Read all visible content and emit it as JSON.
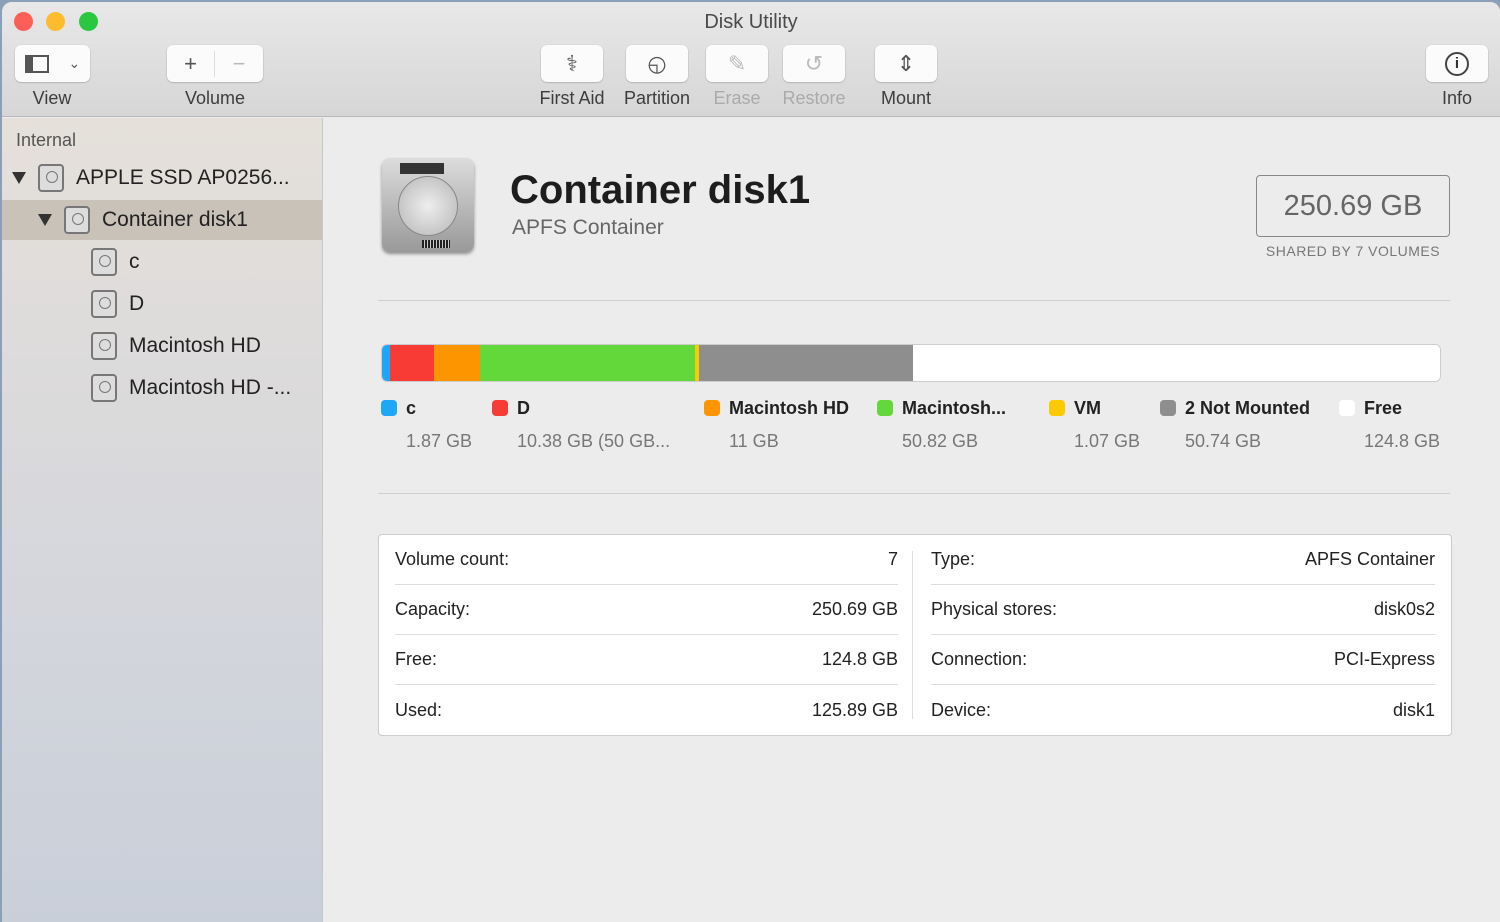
{
  "window": {
    "title": "Disk Utility"
  },
  "toolbar": {
    "view": "View",
    "volume": "Volume",
    "first_aid": "First Aid",
    "partition": "Partition",
    "erase": "Erase",
    "restore": "Restore",
    "mount": "Mount",
    "info": "Info"
  },
  "sidebar": {
    "section": "Internal",
    "items": [
      {
        "label": "APPLE SSD AP0256...",
        "level": 0,
        "expanded": true
      },
      {
        "label": "Container disk1",
        "level": 1,
        "expanded": true,
        "selected": true
      },
      {
        "label": "c",
        "level": 2
      },
      {
        "label": "D",
        "level": 2
      },
      {
        "label": "Macintosh HD",
        "level": 2
      },
      {
        "label": "Macintosh HD -...",
        "level": 2
      }
    ]
  },
  "header": {
    "title": "Container disk1",
    "subtitle": "APFS Container",
    "capacity": "250.69 GB",
    "capacity_label": "SHARED BY 7 VOLUMES"
  },
  "usage": [
    {
      "name": "c",
      "value": "1.87 GB",
      "gb": 1.87,
      "color": "#1ea7f5"
    },
    {
      "name": "D",
      "value": "10.38 GB (50 GB...",
      "gb": 10.38,
      "color": "#f93b35"
    },
    {
      "name": "Macintosh HD",
      "value": "11 GB",
      "gb": 11,
      "color": "#fd9500"
    },
    {
      "name": "Macintosh...",
      "value": "50.82 GB",
      "gb": 50.82,
      "color": "#62d83b"
    },
    {
      "name": "VM",
      "value": "1.07 GB",
      "gb": 1.07,
      "color": "#fdca00"
    },
    {
      "name": "2 Not Mounted",
      "value": "50.74 GB",
      "gb": 50.74,
      "color": "#8e8e8e"
    },
    {
      "name": "Free",
      "value": "124.8 GB",
      "gb": 124.8,
      "color": "#ffffff"
    }
  ],
  "details": {
    "left": [
      {
        "k": "Volume count:",
        "v": "7"
      },
      {
        "k": "Capacity:",
        "v": "250.69 GB"
      },
      {
        "k": "Free:",
        "v": "124.8 GB"
      },
      {
        "k": "Used:",
        "v": "125.89 GB"
      }
    ],
    "right": [
      {
        "k": "Type:",
        "v": "APFS Container"
      },
      {
        "k": "Physical stores:",
        "v": "disk0s2"
      },
      {
        "k": "Connection:",
        "v": "PCI-Express"
      },
      {
        "k": "Device:",
        "v": "disk1"
      }
    ]
  }
}
